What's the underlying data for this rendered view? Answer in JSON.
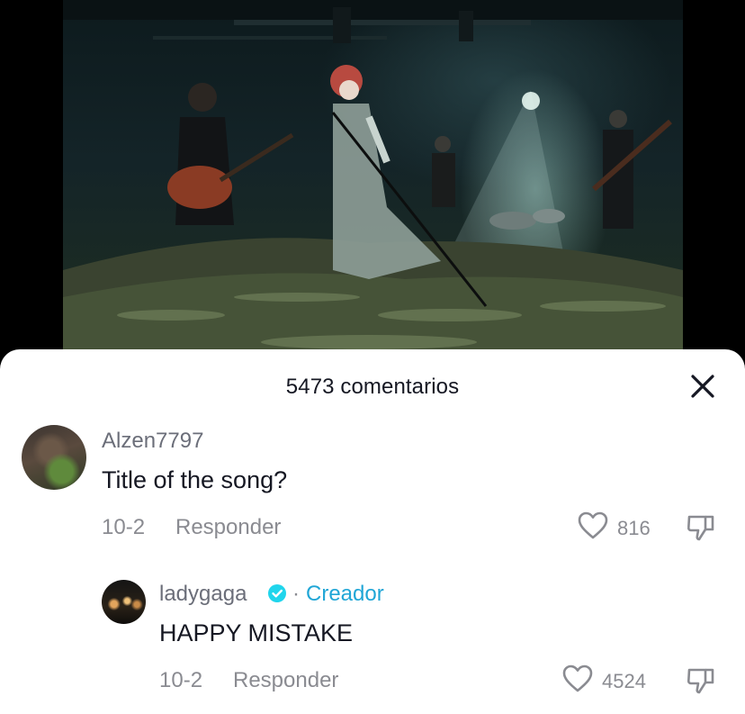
{
  "video": {
    "description_icon": "concert-video-frame"
  },
  "comments_sheet": {
    "title": "5473 comentarios",
    "close_icon": "close-icon"
  },
  "comments": [
    {
      "username": "Alzen7797",
      "text": "Title of the song?",
      "date": "10-2",
      "reply_label": "Responder",
      "likes": "816"
    }
  ],
  "replies": [
    {
      "username": "ladygaga",
      "verified": true,
      "separator": "·",
      "creator_label": "Creador",
      "text": "HAPPY MISTAKE",
      "date": "10-2",
      "reply_label": "Responder",
      "likes": "4524"
    }
  ],
  "colors": {
    "text_primary": "#161823",
    "text_secondary": "#8a8b91",
    "creator_accent": "#20a6d6",
    "sheet_background": "#ffffff",
    "backdrop": "#000000"
  }
}
